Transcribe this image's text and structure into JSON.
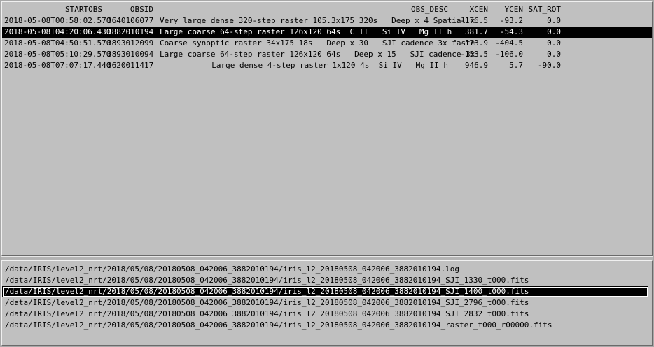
{
  "obs_table": {
    "headers": {
      "startobs": "STARTOBS",
      "obsid": "OBSID",
      "obs_desc": "OBS_DESC",
      "xcen": "XCEN",
      "ycen": "YCEN",
      "sat_rot": "SAT_ROT"
    },
    "selected_index": 1,
    "rows": [
      {
        "startobs": "2018-05-08T00:58:02.570",
        "obsid": "3640106077",
        "obs_desc": "Very large dense 320-step raster 105.3x175 320s   Deep x 4 Spatial x",
        "xcen": "-176.5",
        "ycen": "-93.2",
        "sat_rot": "0.0"
      },
      {
        "startobs": "2018-05-08T04:20:06.430",
        "obsid": "3882010194",
        "obs_desc": "Large coarse 64-step raster 126x120 64s  C II   Si IV   Mg II h",
        "xcen": "381.7",
        "ycen": "-54.3",
        "sat_rot": "0.0"
      },
      {
        "startobs": "2018-05-08T04:50:51.570",
        "obsid": "3893012099",
        "obs_desc": "Coarse synoptic raster 34x175 18s   Deep x 30   SJI cadence 3x faste",
        "xcen": "-173.9",
        "ycen": "-404.5",
        "sat_rot": "0.0"
      },
      {
        "startobs": "2018-05-08T05:10:29.570",
        "obsid": "3893010094",
        "obs_desc": "Large coarse 64-step raster 126x120 64s   Deep x 15   SJI cadence 3x",
        "xcen": "-153.5",
        "ycen": "-106.0",
        "sat_rot": "0.0"
      },
      {
        "startobs": "2018-05-08T07:07:17.440",
        "obsid": "3620011417",
        "obs_desc": "Large dense 4-step raster 1x120 4s  Si IV   Mg II h",
        "xcen": "946.9",
        "ycen": "5.7",
        "sat_rot": "-90.0"
      }
    ]
  },
  "file_list": {
    "selected_index": 2,
    "files": [
      "/data/IRIS/level2_nrt/2018/05/08/20180508_042006_3882010194/iris_l2_20180508_042006_3882010194.log",
      "/data/IRIS/level2_nrt/2018/05/08/20180508_042006_3882010194/iris_l2_20180508_042006_3882010194_SJI_1330_t000.fits",
      "/data/IRIS/level2_nrt/2018/05/08/20180508_042006_3882010194/iris_l2_20180508_042006_3882010194_SJI_1400_t000.fits",
      "/data/IRIS/level2_nrt/2018/05/08/20180508_042006_3882010194/iris_l2_20180508_042006_3882010194_SJI_2796_t000.fits",
      "/data/IRIS/level2_nrt/2018/05/08/20180508_042006_3882010194/iris_l2_20180508_042006_3882010194_SJI_2832_t000.fits",
      "/data/IRIS/level2_nrt/2018/05/08/20180508_042006_3882010194/iris_l2_20180508_042006_3882010194_raster_t000_r00000.fits"
    ]
  },
  "colors": {
    "background": "#c0c0c0",
    "selection_bg": "#000000",
    "selection_fg": "#ffffff"
  }
}
